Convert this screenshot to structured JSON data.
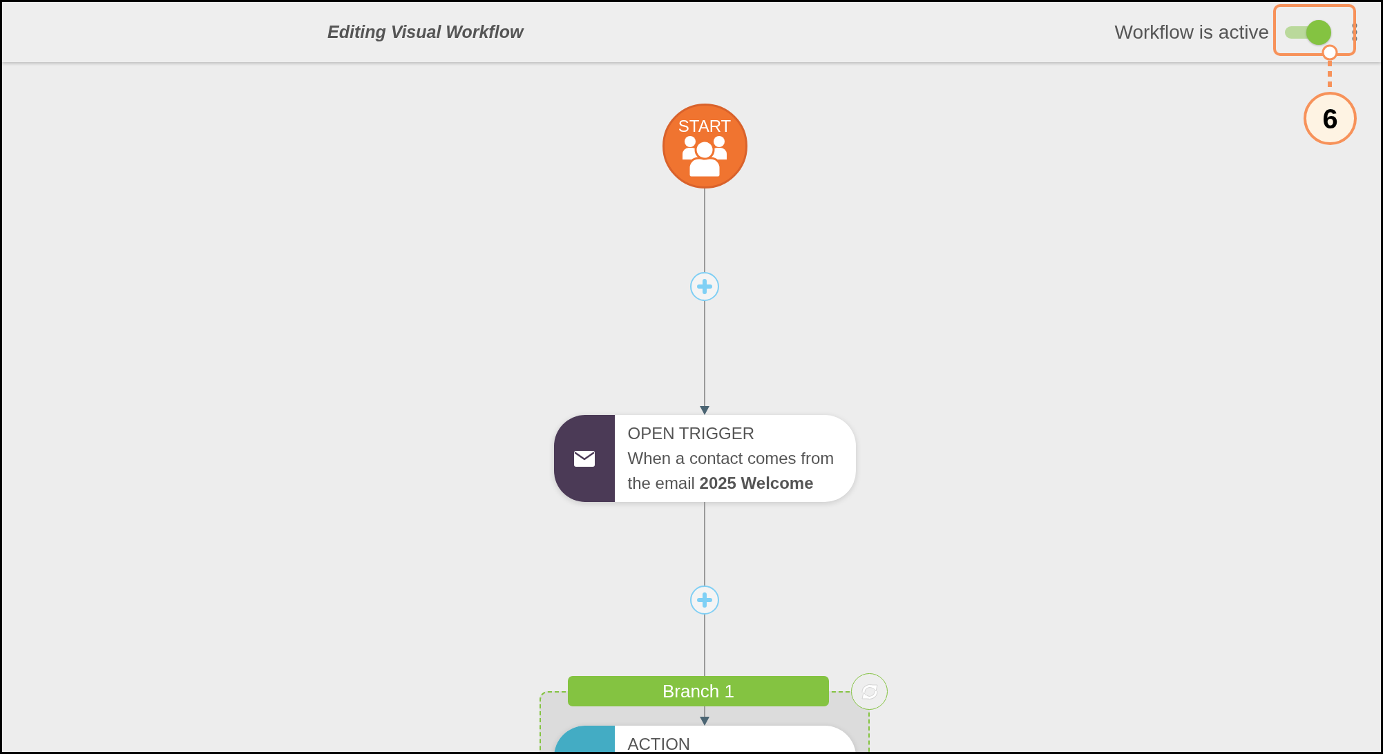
{
  "header": {
    "title": "Editing Visual Workflow",
    "status_label": "Workflow is active",
    "toggle": {
      "on": true
    }
  },
  "annotation": {
    "number": "6"
  },
  "flow": [
    {
      "kind": "start",
      "label": "START"
    },
    {
      "kind": "add"
    },
    {
      "kind": "trigger",
      "title": "OPEN TRIGGER",
      "description": "When a contact comes from the email **2025 Welcome**"
    },
    {
      "kind": "add"
    },
    {
      "kind": "branch",
      "label": "Branch 1",
      "steps": [
        {
          "kind": "action",
          "title": "ACTION"
        }
      ]
    }
  ]
}
